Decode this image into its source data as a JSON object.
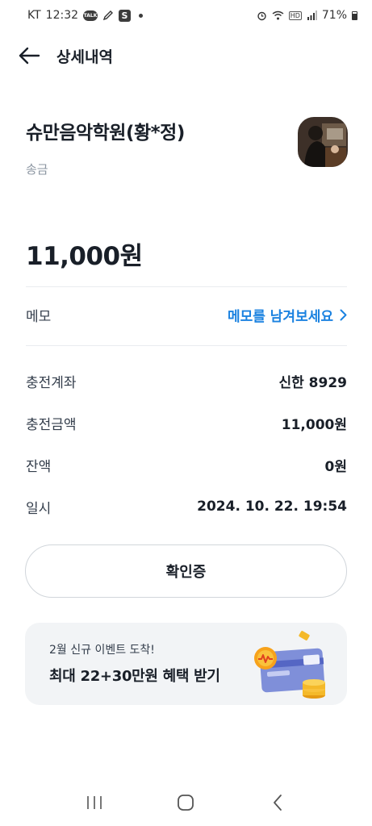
{
  "status_bar": {
    "carrier": "KT",
    "time": "12:32",
    "talk_badge": "TALK",
    "s_badge": "S",
    "hd_badge": "HD",
    "battery": "71%"
  },
  "header": {
    "title": "상세내역"
  },
  "recipient": {
    "name": "슈만음악학원(황*정)",
    "type": "송금"
  },
  "amount": "11,000원",
  "memo": {
    "label": "메모",
    "link": "메모를 남겨보세요"
  },
  "details": [
    {
      "label": "충전계좌",
      "value": "신한 8929"
    },
    {
      "label": "충전금액",
      "value": "11,000원"
    },
    {
      "label": "잔액",
      "value": "0원"
    },
    {
      "label": "일시",
      "value": "2024. 10. 22. 19:54"
    }
  ],
  "confirm_button": "확인증",
  "promo": {
    "subtitle": "2월 신규 이벤트 도착!",
    "title": "최대 22+30만원 혜택 받기"
  },
  "colors": {
    "accent": "#1b82e0",
    "text": "#191f28",
    "muted": "#8b95a1",
    "card": "#f2f4f6"
  }
}
